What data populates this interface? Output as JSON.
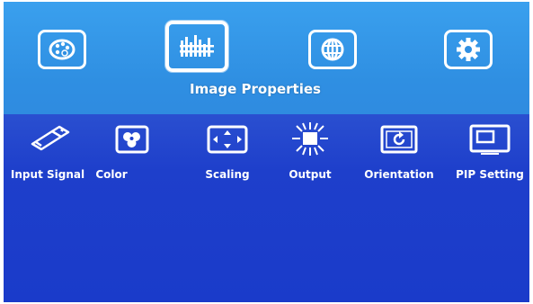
{
  "top_menu": {
    "title": "Image Properties",
    "icons": [
      {
        "name": "palette-icon"
      },
      {
        "name": "equalizer-icon",
        "selected": true
      },
      {
        "name": "globe-icon"
      },
      {
        "name": "gear-icon"
      }
    ]
  },
  "sub_menu": {
    "items": [
      {
        "label": "Input Signal",
        "icon": "usb-plug-icon"
      },
      {
        "label": "Color",
        "icon": "color-circles-icon"
      },
      {
        "label": "Scaling",
        "icon": "scaling-arrows-icon"
      },
      {
        "label": "Output",
        "icon": "sun-output-icon"
      },
      {
        "label": "Orientation",
        "icon": "rotate-screen-icon"
      },
      {
        "label": "PIP Setting",
        "icon": "pip-window-icon"
      }
    ]
  },
  "colors": {
    "top_bar": "#3aa0ee",
    "bottom_area": "#1d3fcc",
    "text": "#ffffff"
  }
}
